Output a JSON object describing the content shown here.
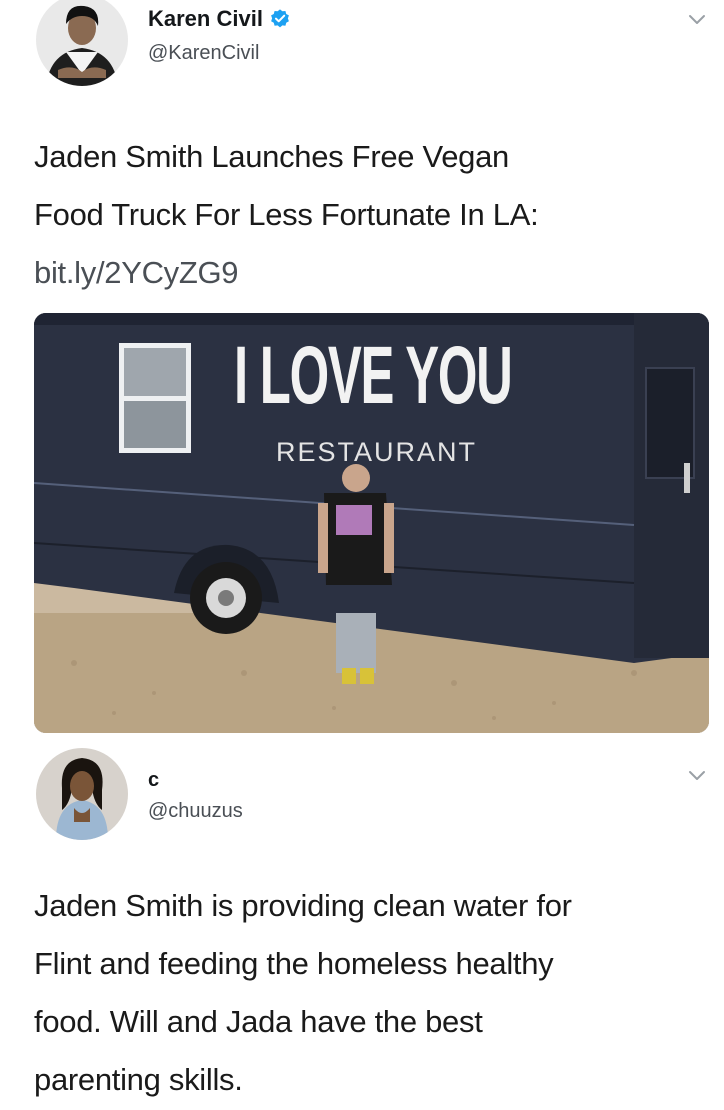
{
  "tweets": [
    {
      "display_name": "Karen Civil",
      "handle": "@KarenCivil",
      "verified": true,
      "text_lines": [
        "Jaden Smith Launches Free Vegan",
        "Food Truck For Less Fortunate In LA:"
      ],
      "link": "bit.ly/2YCyZG9",
      "media": {
        "truck_title": "I LOVE YOU",
        "truck_subtitle": "RESTAURANT"
      }
    },
    {
      "display_name": "c",
      "handle": "@chuuzus",
      "verified": false,
      "text_lines": [
        "Jaden Smith is providing clean water for",
        "Flint and feeding the homeless healthy",
        "food. Will and Jada have the best",
        "parenting skills."
      ]
    }
  ],
  "icons": {
    "verified": "verified-badge-icon",
    "menu": "chevron-down-icon"
  },
  "colors": {
    "verified_blue": "#1da1f2",
    "text": "#1a1a1a",
    "secondary_text": "#4a4f55",
    "truck_body": "#2b3142"
  }
}
